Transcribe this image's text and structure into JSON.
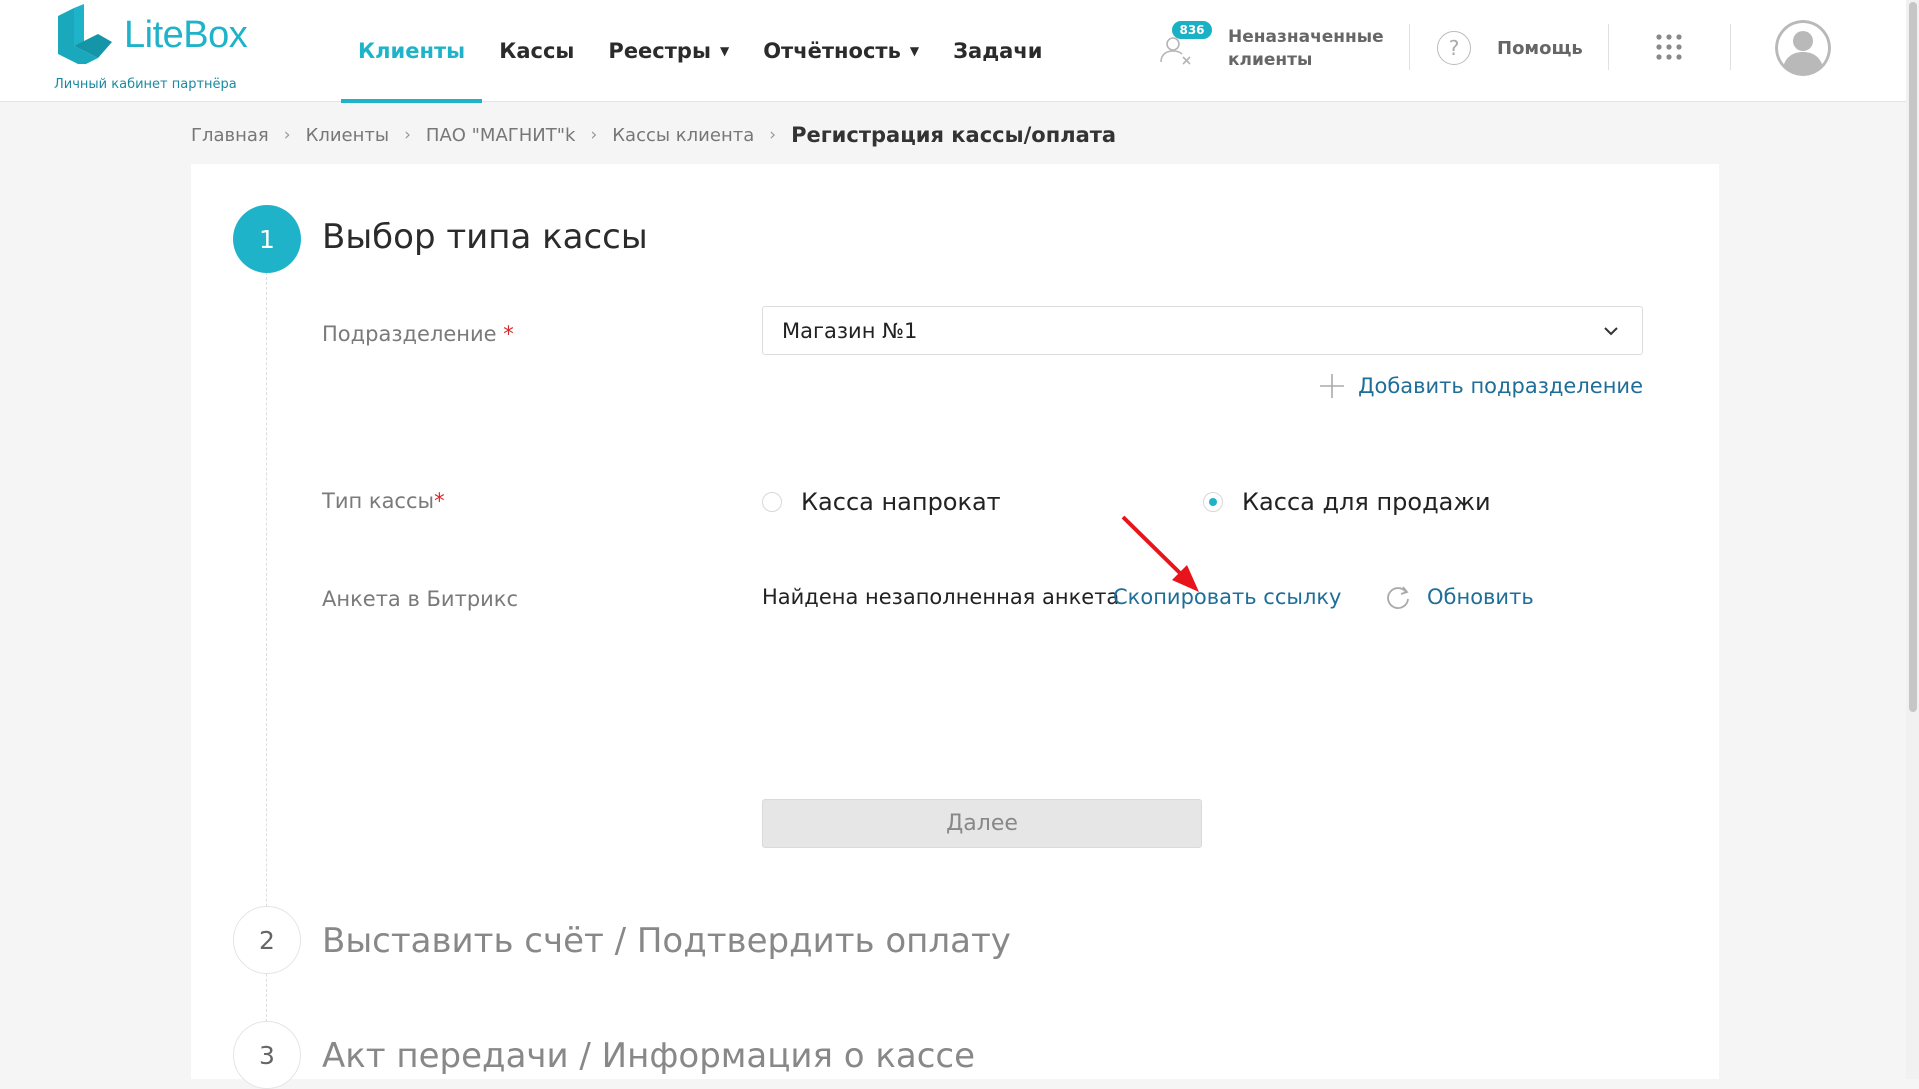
{
  "header": {
    "logo": {
      "name": "LiteBox",
      "subtitle": "Личный кабинет партнёра"
    },
    "nav": [
      {
        "label": "Клиенты",
        "active": true,
        "dropdown": false
      },
      {
        "label": "Кассы",
        "active": false,
        "dropdown": false
      },
      {
        "label": "Реестры",
        "active": false,
        "dropdown": true
      },
      {
        "label": "Отчётность",
        "active": false,
        "dropdown": true
      },
      {
        "label": "Задачи",
        "active": false,
        "dropdown": false
      }
    ],
    "unassigned": {
      "count": "836",
      "label": "Неназначенные клиенты"
    },
    "help": {
      "label": "Помощь"
    }
  },
  "breadcrumb": {
    "items": [
      "Главная",
      "Клиенты",
      "ПАО \"МАГНИТ\"k",
      "Кассы клиента"
    ],
    "current": "Регистрация кассы/оплата"
  },
  "steps": [
    {
      "number": "1",
      "title": "Выбор типа кассы",
      "active": true
    },
    {
      "number": "2",
      "title": "Выставить счёт / Подтвердить оплату",
      "active": false
    },
    {
      "number": "3",
      "title": "Акт передачи / Информация о кассе",
      "active": false
    }
  ],
  "form": {
    "subdivision": {
      "label": "Подразделение",
      "required_mark": "*",
      "value": "Магазин №1",
      "add_label": "Добавить подразделение"
    },
    "kassa_type": {
      "label": "Тип кассы",
      "required_mark": "*",
      "options": [
        {
          "label": "Касса напрокат",
          "checked": false
        },
        {
          "label": "Касса для продажи",
          "checked": true
        }
      ]
    },
    "bitrix": {
      "label": "Анкета в Битрикс",
      "status": "Найдена незаполненная анкета",
      "copy_link_label": "Скопировать ссылку",
      "refresh_label": "Обновить"
    },
    "next_label": "Далее"
  },
  "colors": {
    "accent": "#1fb3c9",
    "link": "#1e6e98",
    "required": "#d9262c",
    "annotation_arrow": "#e8141b"
  }
}
